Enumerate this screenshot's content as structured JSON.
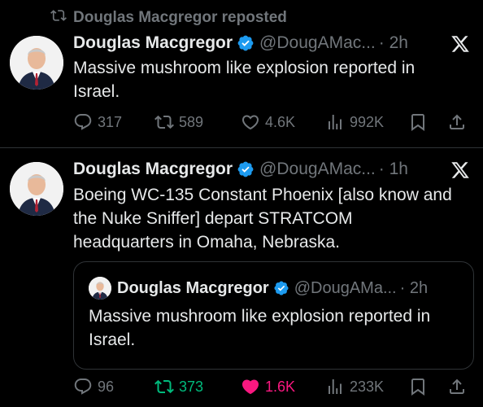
{
  "repost": {
    "label": "Douglas Macgregor reposted"
  },
  "tweet1": {
    "name": "Douglas Macgregor",
    "handle": "@DougAMac...",
    "time": "· 2h",
    "text_line1": "Massive mushroom like explosion reported in",
    "text_line2": "Israel.",
    "replies": "317",
    "reposts": "589",
    "likes": "4.6K",
    "views": "992K"
  },
  "tweet2": {
    "name": "Douglas Macgregor",
    "handle": "@DougAMac...",
    "time": "· 1h",
    "text_line1": "Boeing WC-135 Constant Phoenix [also know and",
    "text_line2": "the Nuke Sniffer] depart STRATCOM",
    "text_line3": "headquarters in Omaha, Nebraska.",
    "quote": {
      "name": "Douglas Macgregor",
      "handle": "@DougAMa...",
      "time": "· 2h",
      "text_line1": "Massive mushroom like explosion reported in",
      "text_line2": "Israel."
    },
    "replies": "96",
    "reposts": "373",
    "likes": "1.6K",
    "views": "233K"
  },
  "colors": {
    "background": "#000000",
    "text": "#e7e9ea",
    "muted": "#71767b",
    "verified": "#1d9bf0",
    "repost_active": "#00ba7c",
    "like_active": "#f91880",
    "border": "#2f3336"
  },
  "icons": [
    "repost-icon",
    "verified-badge-icon",
    "x-logo-icon",
    "reply-icon",
    "like-icon",
    "views-icon",
    "bookmark-icon",
    "share-icon"
  ]
}
